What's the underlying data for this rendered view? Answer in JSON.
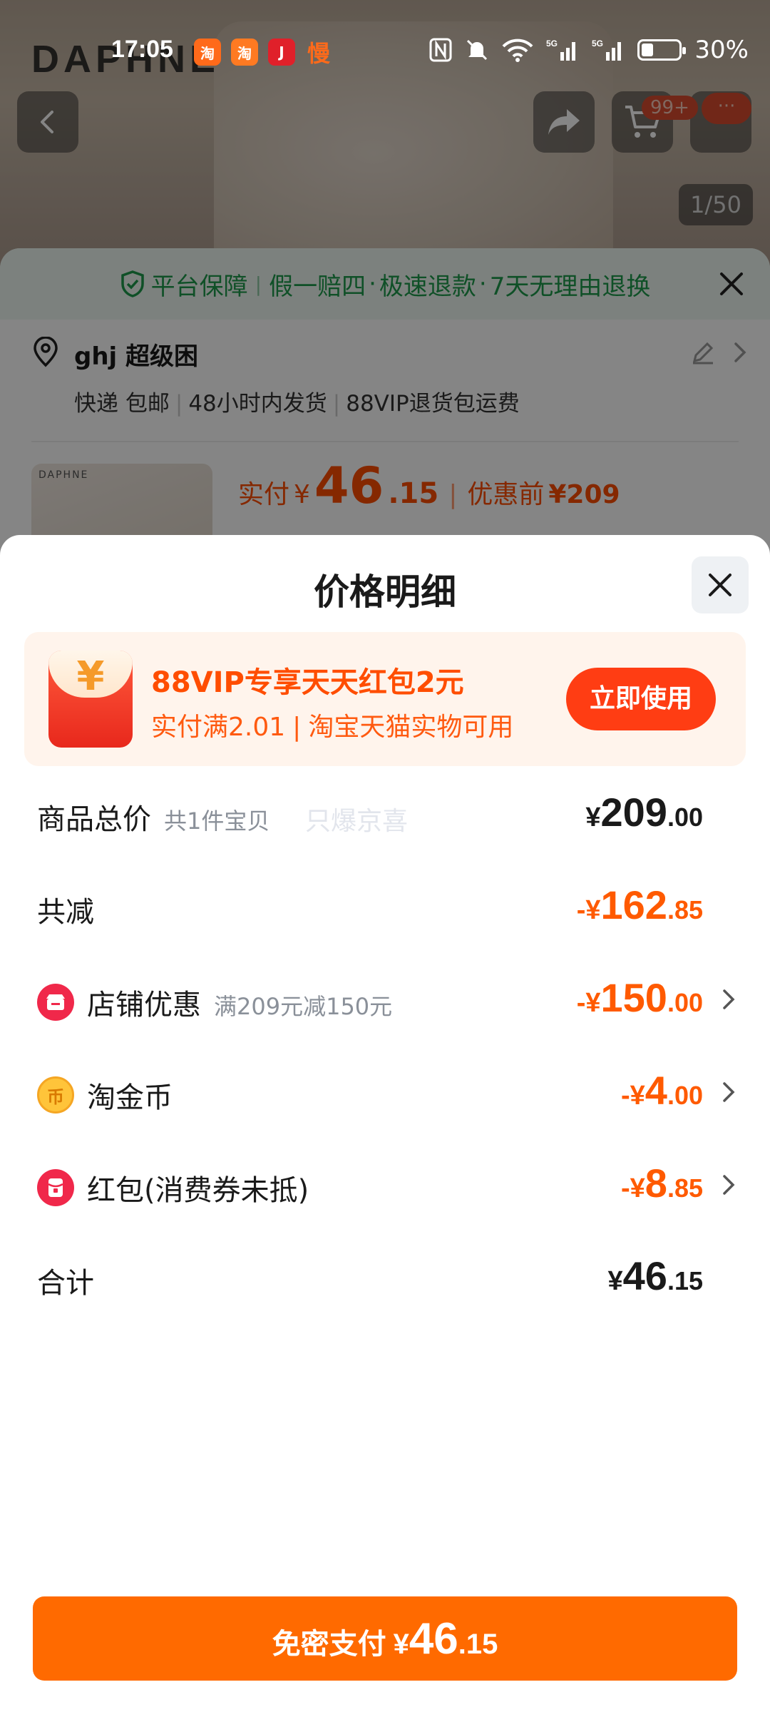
{
  "status_bar": {
    "time": "17:05",
    "battery": "30%",
    "notification_apps": [
      "taobao-icon",
      "taobao-icon",
      "jd-icon",
      "slow-icon"
    ],
    "slow_app_glyph": "慢"
  },
  "background_page": {
    "brand_logo": "DAPHNE",
    "cart_badge": "99+",
    "more_badge": "···",
    "image_counter": "1/50",
    "guarantee": {
      "lead": "平台保障",
      "items": [
        "假一赔四",
        "极速退款",
        "7天无理由退换"
      ]
    },
    "address": {
      "name": "ghj 超级困",
      "shipping": "快递 包邮",
      "dispatch": "48小时内发货",
      "return_policy": "88VIP退货包运费"
    },
    "product": {
      "thumb_brand": "DAPHNE",
      "paid_label": "实付",
      "currency": "¥",
      "paid_int": "46",
      "paid_dec": ".15",
      "before_label": "优惠前",
      "before_price": "¥209"
    }
  },
  "panel": {
    "title": "价格明细",
    "promo": {
      "icon_glyph": "¥",
      "title": "88VIP专享天天红包2元",
      "condition": "实付满2.01",
      "scope": "淘宝天猫实物可用",
      "button": "立即使用"
    },
    "watermark": "只爆京喜",
    "rows": {
      "total": {
        "label": "商品总价",
        "note": "共1件宝贝",
        "sign": "¥",
        "int": "209",
        "dec": ".00"
      },
      "reduced": {
        "label": "共减",
        "sign": "-¥",
        "int": "162",
        "dec": ".85"
      },
      "shop": {
        "label": "店铺优惠",
        "note": "满209元减150元",
        "sign": "-¥",
        "int": "150",
        "dec": ".00"
      },
      "coin": {
        "label": "淘金币",
        "icon_glyph": "币",
        "sign": "-¥",
        "int": "4",
        "dec": ".00"
      },
      "redpacket": {
        "label": "红包(消费券未抵)",
        "sign": "-¥",
        "int": "8",
        "dec": ".85"
      },
      "sum": {
        "label": "合计",
        "sign": "¥",
        "int": "46",
        "dec": ".15"
      }
    },
    "pay_button": {
      "label": "免密支付",
      "sign": "¥",
      "int": "46",
      "dec": ".15"
    }
  },
  "colors": {
    "accent_orange": "#ff6a00",
    "price_orange": "#ff5a00",
    "promo_red": "#ff3d13",
    "guarantee_green": "#1e9a4c"
  }
}
